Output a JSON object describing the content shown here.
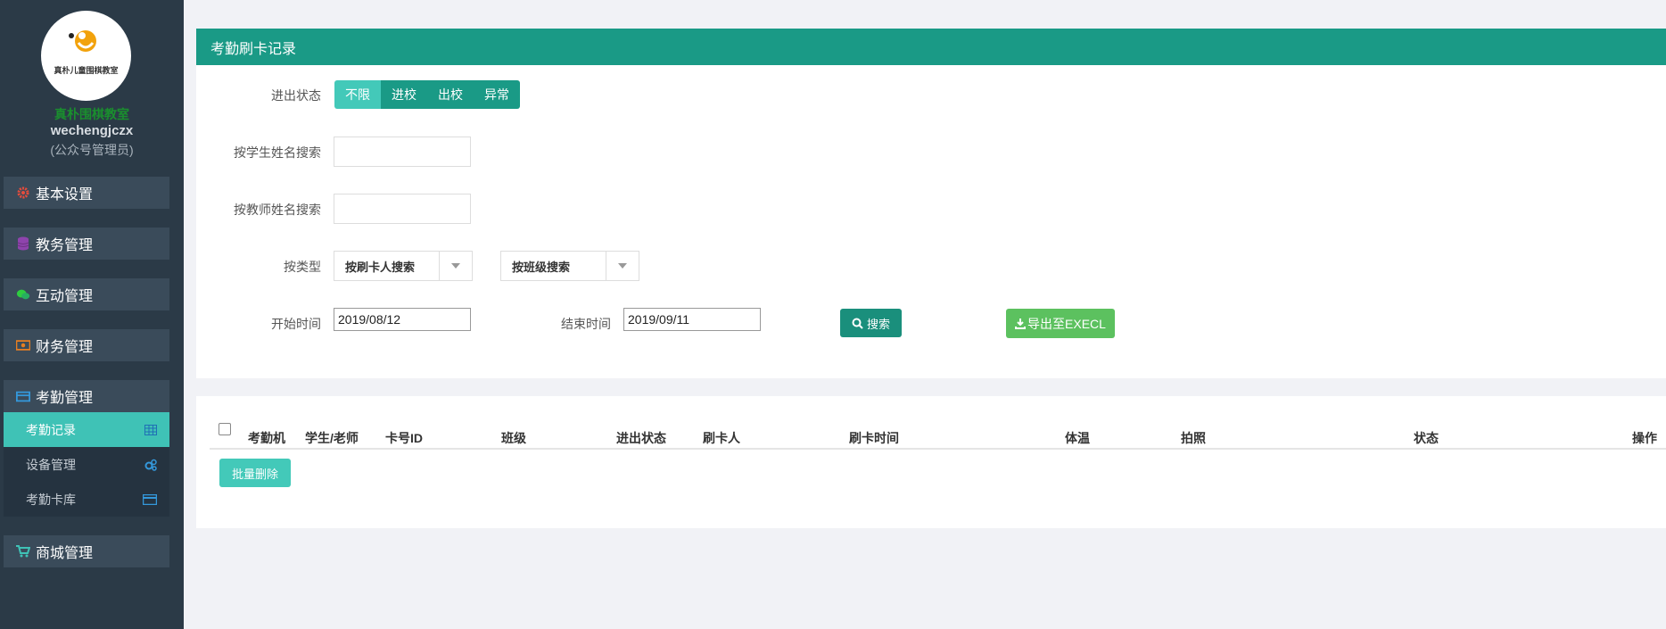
{
  "sidebar": {
    "logo_text": "真朴儿童围棋教室",
    "org_name": "真朴围棋教室",
    "account": "wechengjczx",
    "role": "(公众号管理员)",
    "menu": [
      {
        "label": "基本设置",
        "icon": "gear-icon",
        "color": "#e74c3c"
      },
      {
        "label": "教务管理",
        "icon": "database-icon",
        "color": "#8e44ad"
      },
      {
        "label": "互动管理",
        "icon": "wechat-icon",
        "color": "#2ecc40"
      },
      {
        "label": "财务管理",
        "icon": "money-icon",
        "color": "#e67e22"
      },
      {
        "label": "考勤管理",
        "icon": "card-icon",
        "color": "#3498db"
      },
      {
        "label": "商城管理",
        "icon": "cart-icon",
        "color": "#3fc2b6"
      }
    ],
    "submenu": [
      {
        "label": "考勤记录",
        "icon": "table-icon",
        "active": true
      },
      {
        "label": "设备管理",
        "icon": "gears-icon",
        "active": false
      },
      {
        "label": "考勤卡库",
        "icon": "card-icon",
        "active": false
      }
    ]
  },
  "filters": {
    "panel_title": "考勤刷卡记录",
    "status_label": "进出状态",
    "status_options": [
      "不限",
      "进校",
      "出校",
      "异常"
    ],
    "student_search_label": "按学生姓名搜索",
    "teacher_search_label": "按教师姓名搜索",
    "type_label": "按类型",
    "type_select": "按刷卡人搜索",
    "class_select": "按班级搜索",
    "start_label": "开始时间",
    "start_value": "2019/08/12",
    "end_label": "结束时间",
    "end_value": "2019/09/11",
    "search_button": "搜索",
    "export_button": "导出至EXECL"
  },
  "table": {
    "columns": [
      "考勤机",
      "学生/老师",
      "卡号ID",
      "班级",
      "进出状态",
      "刷卡人",
      "刷卡时间",
      "体温",
      "拍照",
      "状态",
      "操作"
    ],
    "batch_delete": "批量删除"
  }
}
